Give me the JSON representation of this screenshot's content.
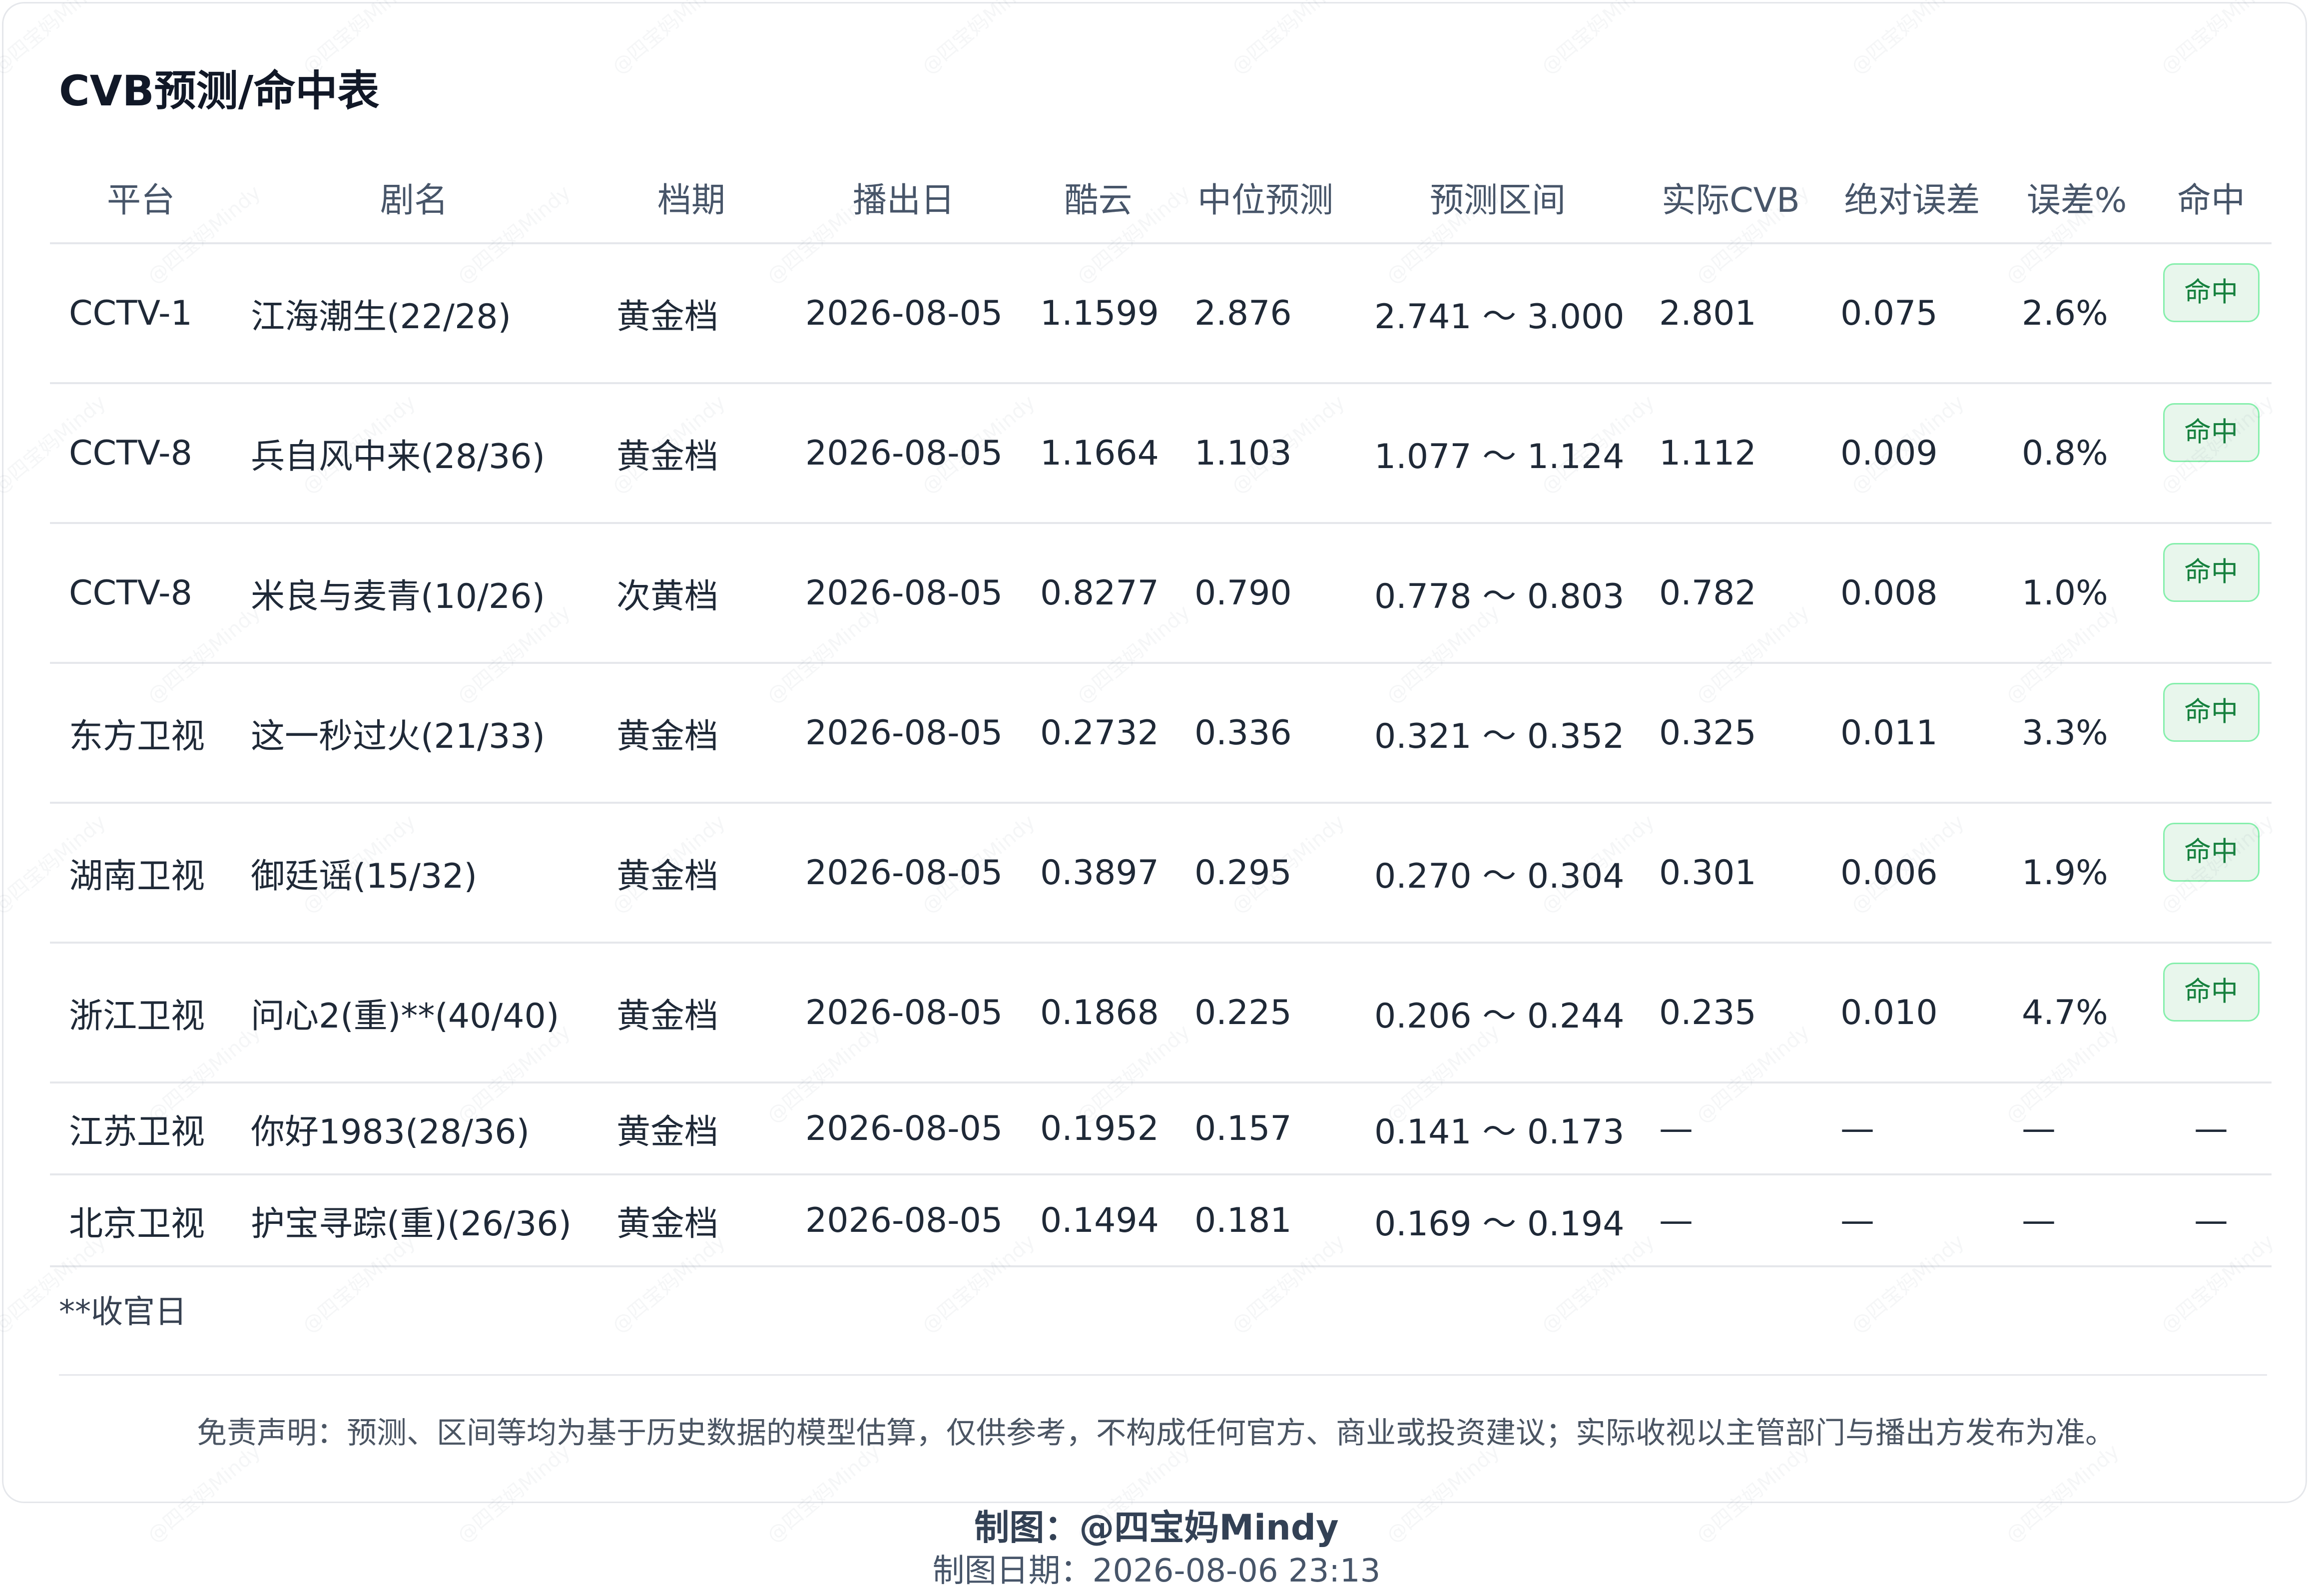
{
  "title": "CVB预测/命中表",
  "table": {
    "columns": [
      "平台",
      "剧名",
      "档期",
      "播出日",
      "酷云",
      "中位预测",
      "预测区间",
      "实际CVB",
      "绝对误差",
      "误差%",
      "命中"
    ],
    "rows": [
      {
        "platform": "CCTV-1",
        "drama": "江海潮生(22/28)",
        "slot": "黄金档",
        "date": "2026-08-05",
        "kuyun": "1.1599",
        "median": "2.876",
        "range": "2.741 ～ 3.000",
        "actual": "2.801",
        "abs_err": "0.075",
        "err_pct": "2.6%",
        "hit": "命中"
      },
      {
        "platform": "CCTV-8",
        "drama": "兵自风中来(28/36)",
        "slot": "黄金档",
        "date": "2026-08-05",
        "kuyun": "1.1664",
        "median": "1.103",
        "range": "1.077 ～ 1.124",
        "actual": "1.112",
        "abs_err": "0.009",
        "err_pct": "0.8%",
        "hit": "命中"
      },
      {
        "platform": "CCTV-8",
        "drama": "米良与麦青(10/26)",
        "slot": "次黄档",
        "date": "2026-08-05",
        "kuyun": "0.8277",
        "median": "0.790",
        "range": "0.778 ～ 0.803",
        "actual": "0.782",
        "abs_err": "0.008",
        "err_pct": "1.0%",
        "hit": "命中"
      },
      {
        "platform": "东方卫视",
        "drama": "这一秒过火(21/33)",
        "slot": "黄金档",
        "date": "2026-08-05",
        "kuyun": "0.2732",
        "median": "0.336",
        "range": "0.321 ～ 0.352",
        "actual": "0.325",
        "abs_err": "0.011",
        "err_pct": "3.3%",
        "hit": "命中"
      },
      {
        "platform": "湖南卫视",
        "drama": "御廷谣(15/32)",
        "slot": "黄金档",
        "date": "2026-08-05",
        "kuyun": "0.3897",
        "median": "0.295",
        "range": "0.270 ～ 0.304",
        "actual": "0.301",
        "abs_err": "0.006",
        "err_pct": "1.9%",
        "hit": "命中"
      },
      {
        "platform": "浙江卫视",
        "drama": "问心2(重)**(40/40)",
        "slot": "黄金档",
        "date": "2026-08-05",
        "kuyun": "0.1868",
        "median": "0.225",
        "range": "0.206 ～ 0.244",
        "actual": "0.235",
        "abs_err": "0.010",
        "err_pct": "4.7%",
        "hit": "命中"
      },
      {
        "platform": "江苏卫视",
        "drama": "你好1983(28/36)",
        "slot": "黄金档",
        "date": "2026-08-05",
        "kuyun": "0.1952",
        "median": "0.157",
        "range": "0.141 ～ 0.173",
        "actual": "—",
        "abs_err": "—",
        "err_pct": "—",
        "hit": "—"
      },
      {
        "platform": "北京卫视",
        "drama": "护宝寻踪(重)(26/36)",
        "slot": "黄金档",
        "date": "2026-08-05",
        "kuyun": "0.1494",
        "median": "0.181",
        "range": "0.169 ～ 0.194",
        "actual": "—",
        "abs_err": "—",
        "err_pct": "—",
        "hit": "—"
      }
    ]
  },
  "note": "**收官日",
  "disclaimer": "免责声明：预测、区间等均为基于历史数据的模型估算，仅供参考，不构成任何官方、商业或投资建议；实际收视以主管部门与播出方发布为准。",
  "credit": "制图：@四宝妈Mindy",
  "credit_date": "制图日期：2026-08-06 23:13",
  "watermark": "@四宝妈Mindy",
  "colors": {
    "hit_text": "#15803d",
    "hit_bg": "#e8f6ec",
    "hit_border": "#86efac",
    "header_text": "#475569",
    "border": "#e5e7eb"
  }
}
